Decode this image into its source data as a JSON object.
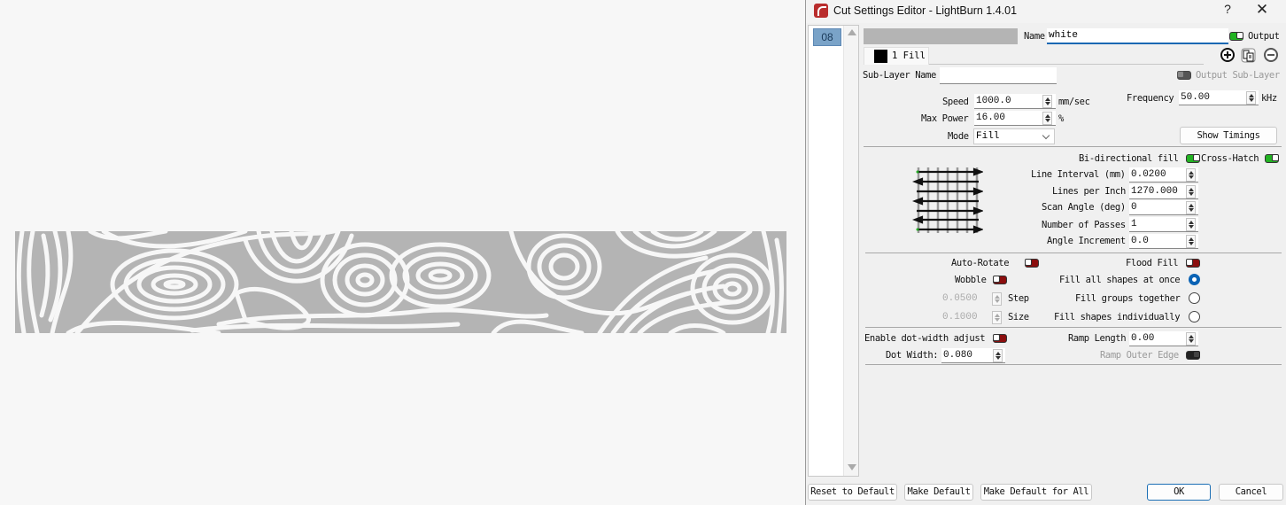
{
  "canvas": {
    "pattern_name": "damascus-contour-fill",
    "pattern_color": "#b4b4b4"
  },
  "dialog": {
    "title": "Cut Settings Editor - LightBurn 1.4.01",
    "help_label": "?",
    "close_label": "✕",
    "layer_list": [
      {
        "label": "08",
        "selected": true
      }
    ],
    "header": {
      "layer_color": "#b4b4b4",
      "name_label": "Name",
      "name_value": "white",
      "output_label": "Output",
      "output_on": true
    },
    "tabs": [
      {
        "label": "1 Fill",
        "swatch_color": "#000000",
        "active": true
      }
    ],
    "sublayer": {
      "name_label": "Sub-Layer Name",
      "name_value": "",
      "output_label": "Output Sub-Layer",
      "output_on": false
    },
    "params": {
      "speed_label": "Speed",
      "speed_value": "1000.0",
      "speed_unit": "mm/sec",
      "max_power_label": "Max Power",
      "max_power_value": "16.00",
      "max_power_unit": "%",
      "mode_label": "Mode",
      "mode_value": "Fill",
      "frequency_label": "Frequency",
      "frequency_value": "50.00",
      "frequency_unit": "kHz",
      "show_timings_label": "Show Timings"
    },
    "fill": {
      "bidirectional_label": "Bi-directional fill",
      "bidirectional_on": true,
      "crosshatch_label": "Cross-Hatch",
      "crosshatch_on": true,
      "line_interval_label": "Line Interval (mm)",
      "line_interval_value": "0.0200",
      "lines_per_inch_label": "Lines per Inch",
      "lines_per_inch_value": "1270.000",
      "scan_angle_label": "Scan Angle (deg)",
      "scan_angle_value": "0",
      "passes_label": "Number of Passes",
      "passes_value": "1",
      "angle_increment_label": "Angle Increment",
      "angle_increment_value": "0.0"
    },
    "options": {
      "auto_rotate_label": "Auto-Rotate",
      "auto_rotate_on": false,
      "flood_fill_label": "Flood Fill",
      "flood_fill_on": false,
      "wobble_label": "Wobble",
      "wobble_on": false,
      "step_value": "0.0500",
      "step_label": "Step",
      "size_value": "0.1000",
      "size_label": "Size",
      "fill_all_label": "Fill all shapes at once",
      "fill_groups_label": "Fill groups together",
      "fill_individually_label": "Fill shapes individually",
      "fill_mode_selected": "Fill all shapes at once"
    },
    "dot": {
      "enable_label": "Enable dot-width adjust",
      "enable_on": false,
      "dot_width_label": "Dot Width:",
      "dot_width_value": "0.080",
      "ramp_length_label": "Ramp Length",
      "ramp_length_value": "0.00",
      "ramp_outer_label": "Ramp Outer Edge",
      "ramp_outer_on": false
    },
    "footer": {
      "reset_label": "Reset to Default",
      "make_default_label": "Make Default",
      "make_default_all_label": "Make Default for All",
      "ok_label": "OK",
      "cancel_label": "Cancel"
    }
  }
}
